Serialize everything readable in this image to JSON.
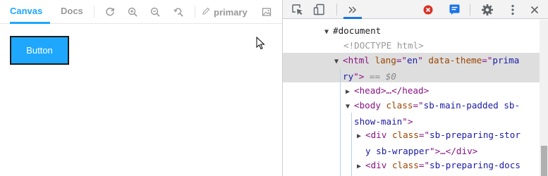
{
  "storybook": {
    "tabs": [
      {
        "label": "Canvas",
        "active": true
      },
      {
        "label": "Docs",
        "active": false
      }
    ],
    "toolbar_icons": [
      "reload-icon",
      "zoom-in-icon",
      "zoom-out-icon",
      "zoom-reset-icon"
    ],
    "theme_label": "primary",
    "story_button_label": "Button",
    "accent_color": "#1ea7fd"
  },
  "devtools": {
    "toolbar_icons": [
      "inspect-element-icon",
      "device-toolbar-icon",
      "more-tabs-icon",
      "error-badge-icon",
      "console-message-icon",
      "settings-gear-icon",
      "vertical-dots-icon",
      "close-icon"
    ],
    "tree": {
      "document": "#document",
      "doctype": "<!DOCTYPE html>",
      "html_open": "<html",
      "html_lang_attr": "lang",
      "html_lang_eq": "=\"",
      "html_lang_value": "en",
      "html_theme_attr": "data-theme",
      "html_theme_eq": "=\"",
      "html_theme_value_part1": "prima",
      "html_theme_value_part2": "ry",
      "html_close_bracket": "\">",
      "html_eq_sign": " == ",
      "html_dollar": "$0",
      "head": "<head>…</head>",
      "body_open": "<body",
      "body_class_attr": "class",
      "body_eq": "=\"",
      "body_class_part1": "sb-main-padded sb-",
      "body_class_part2": "show-main",
      "body_close": "\">",
      "div1_open": "<div",
      "div1_class_attr": "class",
      "div1_eq": "=\"",
      "div1_class_part1": "sb-preparing-stor",
      "div1_class_part2": "y sb-wrapper",
      "div1_close": "\">…</div>",
      "div2_open": "<div",
      "div2_class_attr": "class",
      "div2_eq": "=\"",
      "div2_class_part1": "sb-preparing-docs"
    }
  }
}
